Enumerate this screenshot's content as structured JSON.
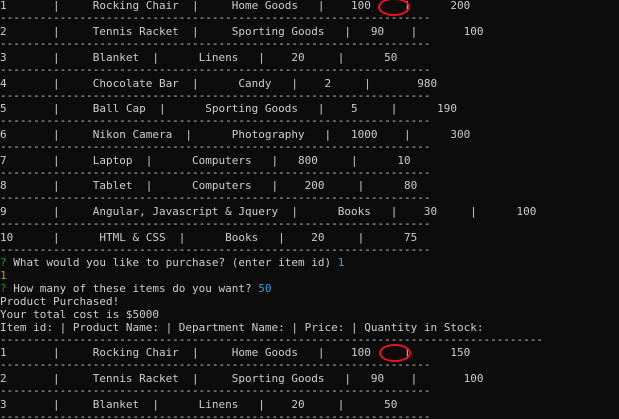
{
  "rows_top": [
    {
      "text": "1       |     Rocking Chair  |     Home Goods   |    100     |"
    },
    {
      "text": "2       |     Tennis Racket  |     Sporting Goods   |   90    |       100"
    },
    {
      "text": "3       |     Blanket  |      Linens   |    20     |      50"
    },
    {
      "text": "4       |     Chocolate Bar  |      Candy   |    2     |       980"
    },
    {
      "text": "5       |     Ball Cap  |      Sporting Goods   |    5     |      190"
    },
    {
      "text": "6       |     Nikon Camera  |      Photography   |   1000    |      300"
    },
    {
      "text": "7       |     Laptop  |      Computers   |   800     |      10"
    },
    {
      "text": "8       |     Tablet  |      Computers   |    200     |      80"
    },
    {
      "text": "9       |     Angular, Javascript & Jquery  |      Books   |    30     |      100"
    },
    {
      "text": "10      |      HTML & CSS  |      Books   |    20     |      75"
    }
  ],
  "highlight_top": "200",
  "separator": "-----------------------------------------------------------------",
  "separator_long": "----------------------------------------------------------------------------------",
  "prompt": {
    "mark": "?",
    "q1_text": " What would you like to purchase? (enter item id) ",
    "q1_answer": "1",
    "q1_echo": "1",
    "q2_text": " How many of these items do you want? ",
    "q2_answer": "50"
  },
  "purchased": "Product Purchased!",
  "total": "Your total cost is $5000",
  "header": "Item id: | Product Name: | Department Name: | Price: | Quantity in Stock:",
  "rows_bottom": [
    {
      "text": "1       |     Rocking Chair  |     Home Goods   |    100     |"
    },
    {
      "text": "2       |     Tennis Racket  |     Sporting Goods   |   90    |       100"
    },
    {
      "text": "3       |     Blanket  |      Linens   |    20     |      50"
    }
  ],
  "highlight_bottom": "150",
  "colors": {
    "background": "#0c0c0c",
    "text": "#cccccc",
    "prompt_green": "#13a10e",
    "answer_blue": "#3b9ad9",
    "echo_yellow": "#c19c00",
    "circle_red": "#e81123"
  }
}
